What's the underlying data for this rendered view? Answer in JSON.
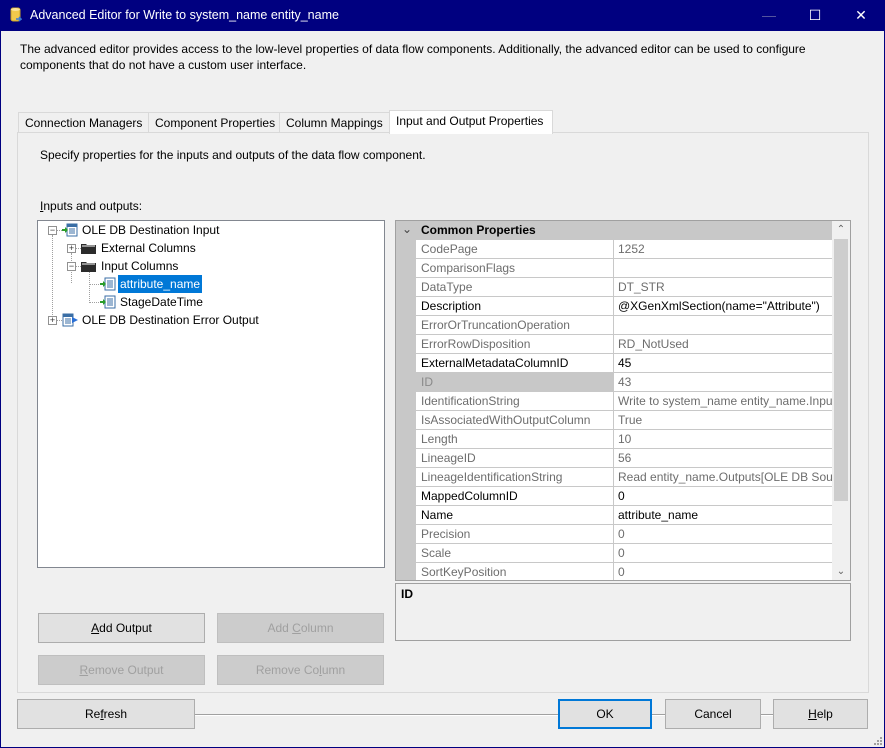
{
  "window": {
    "title": "Advanced Editor for Write to system_name entity_name",
    "controls": {
      "minimize": "—",
      "maximize": "☐",
      "close": "✕"
    }
  },
  "intro_text": "The advanced editor provides access to the low-level properties of data flow components. Additionally, the advanced editor can be used to configure components that do not have a custom user interface.",
  "tabs": [
    {
      "label": "Connection Managers",
      "active": false
    },
    {
      "label": "Component Properties",
      "active": false
    },
    {
      "label": "Column Mappings",
      "active": false
    },
    {
      "label": "Input and Output Properties",
      "active": true
    }
  ],
  "panel": {
    "description": "Specify properties for the inputs and outputs of the data flow component.",
    "io_label_prefix": "",
    "io_label_mnemonic": "I",
    "io_label_rest": "nputs and outputs:"
  },
  "tree": {
    "nodes": [
      {
        "label": "OLE DB Destination Input",
        "icon": "input-icon",
        "expander": "−"
      },
      {
        "label": "External Columns",
        "icon": "folder-icon",
        "expander": "+"
      },
      {
        "label": "Input Columns",
        "icon": "folder-icon",
        "expander": "−"
      },
      {
        "label": "attribute_name",
        "icon": "column-icon",
        "selected": true
      },
      {
        "label": "StageDateTime",
        "icon": "column-icon"
      },
      {
        "label": "OLE DB Destination Error Output",
        "icon": "output-icon",
        "expander": "+"
      }
    ]
  },
  "buttons": {
    "add_output": {
      "mn": "A",
      "rest": "dd Output"
    },
    "add_column": {
      "pre": "Add ",
      "mn": "C",
      "rest": "olumn"
    },
    "remove_output": {
      "mn": "R",
      "rest": "emove Output"
    },
    "remove_column": {
      "pre": "Remove Co",
      "mn": "l",
      "rest": "umn"
    },
    "refresh": {
      "pre": "Re",
      "mn": "f",
      "rest": "resh"
    },
    "ok": "OK",
    "cancel": "Cancel",
    "help": {
      "mn": "H",
      "rest": "elp"
    }
  },
  "properties": {
    "category": "Common Properties",
    "category_toggle": "⌄",
    "rows": [
      {
        "name": "CodePage",
        "value": "1252",
        "editable": false
      },
      {
        "name": "ComparisonFlags",
        "value": "",
        "editable": false
      },
      {
        "name": "DataType",
        "value": "DT_STR",
        "editable": false
      },
      {
        "name": "Description",
        "value": "@XGenXmlSection(name=\"Attribute\")",
        "editable": true
      },
      {
        "name": "ErrorOrTruncationOperation",
        "value": "",
        "editable": false
      },
      {
        "name": "ErrorRowDisposition",
        "value": "RD_NotUsed",
        "editable": false
      },
      {
        "name": "ExternalMetadataColumnID",
        "value": "45",
        "editable": true
      },
      {
        "name": "ID",
        "value": "43",
        "editable": false,
        "selected": true
      },
      {
        "name": "IdentificationString",
        "value": "Write to system_name entity_name.Input",
        "editable": false
      },
      {
        "name": "IsAssociatedWithOutputColumn",
        "value": "True",
        "editable": false
      },
      {
        "name": "Length",
        "value": "10",
        "editable": false
      },
      {
        "name": "LineageID",
        "value": "56",
        "editable": false
      },
      {
        "name": "LineageIdentificationString",
        "value": "Read entity_name.Outputs[OLE DB Source",
        "editable": false
      },
      {
        "name": "MappedColumnID",
        "value": "0",
        "editable": true
      },
      {
        "name": "Name",
        "value": "attribute_name",
        "editable": true
      },
      {
        "name": "Precision",
        "value": "0",
        "editable": false
      },
      {
        "name": "Scale",
        "value": "0",
        "editable": false
      },
      {
        "name": "SortKeyPosition",
        "value": "0",
        "editable": false
      }
    ],
    "scroll_up": "⌃",
    "scroll_down": "⌄",
    "description_title": "ID"
  }
}
